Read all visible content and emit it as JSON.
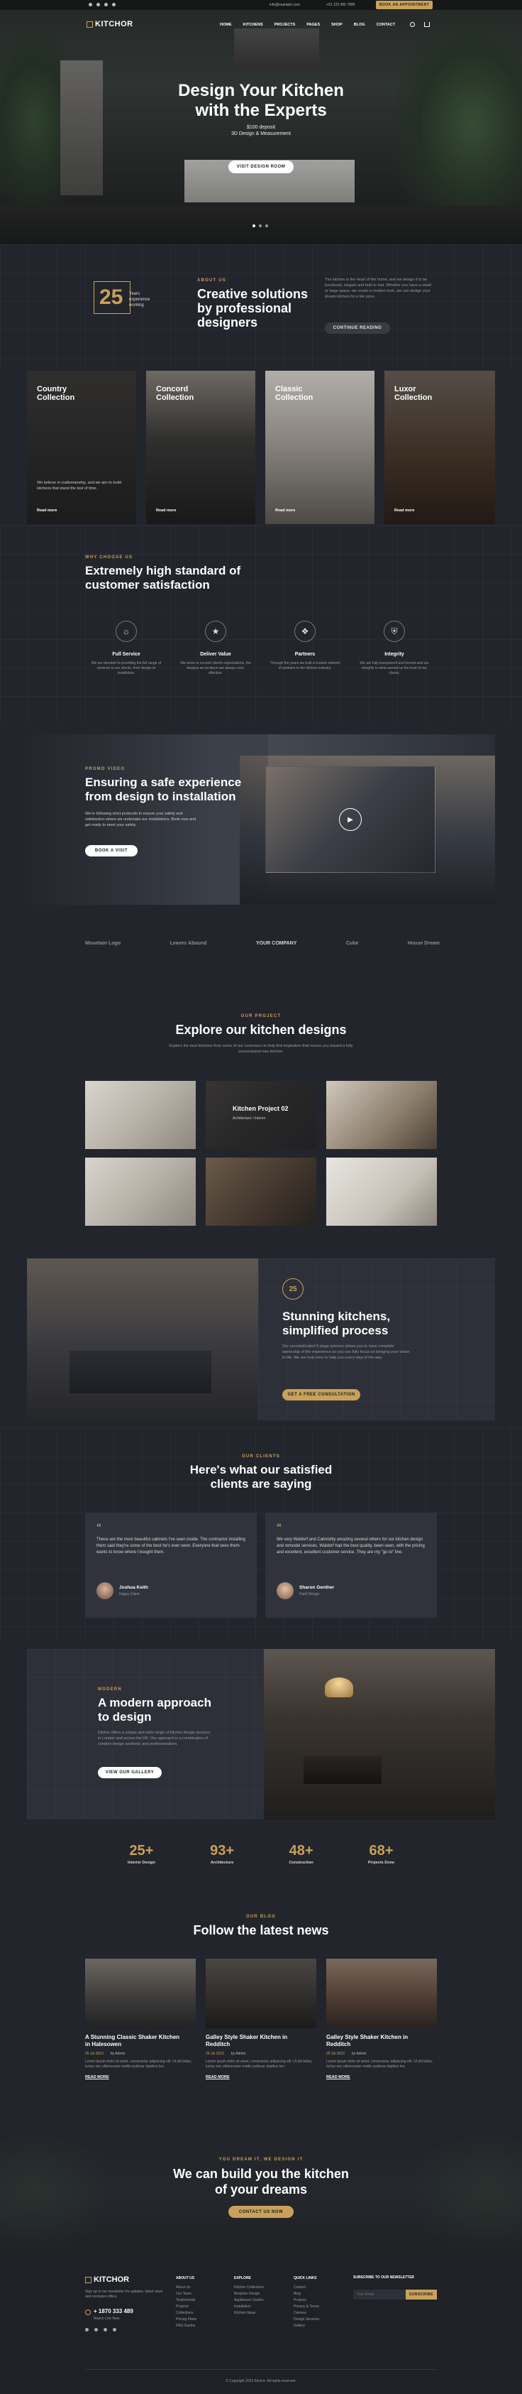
{
  "topbar": {
    "email": "info@example.com",
    "phone": "+91 123 456 7890",
    "cta": "BOOK AN APPOINTMENT"
  },
  "nav": {
    "brand": "KITCHOR",
    "items": [
      "HOME",
      "KITCHENS",
      "PROJECTS",
      "PAGES",
      "SHOP",
      "BLOG",
      "CONTACT"
    ]
  },
  "hero": {
    "title_line1": "Design Your Kitchen",
    "title_line2": "with the Experts",
    "sub1": "$100 deposit",
    "sub2": "3D Design & Measurement",
    "button": "VISIT DESIGN ROOM"
  },
  "about": {
    "years": "25",
    "years_label1": "Years",
    "years_label2": "experience",
    "years_label3": "working",
    "label": "ABOUT US",
    "title_line1": "Creative solutions",
    "title_line2": "by professional",
    "title_line3": "designers",
    "text": "The kitchen is the heart of the home, and we design it to be functional, elegant and built to last. Whether you have a small or large space, we create a modern look, we can design your dream kitchen for a fair price.",
    "button": "CONTINUE READING"
  },
  "collections": [
    {
      "title1": "Country",
      "title2": "Collection",
      "text": "We believe in craftsmanship, and we aim to build kitchens that stand the test of time.",
      "link": "Read more"
    },
    {
      "title1": "Concord",
      "title2": "Collection",
      "text": "",
      "link": "Read more"
    },
    {
      "title1": "Classic",
      "title2": "Collection",
      "text": "",
      "link": "Read more"
    },
    {
      "title1": "Luxor",
      "title2": "Collection",
      "text": "",
      "link": "Read more"
    }
  ],
  "why": {
    "label": "WHY CHOOSE US",
    "title_line1": "Extremely high standard of",
    "title_line2": "customer satisfaction",
    "features": [
      {
        "icon": "lightbulb-icon",
        "title": "Full Service",
        "text": "We are devoted to providing the full range of services to our clients, from design to installation."
      },
      {
        "icon": "tag-icon",
        "title": "Deliver Value",
        "text": "We strive to exceed client's expectations, the designs we produce are always cost-effective."
      },
      {
        "icon": "handshake-icon",
        "title": "Partners",
        "text": "Through the years we built a trusted network of partners in the kitchen industry."
      },
      {
        "icon": "shield-icon",
        "title": "Integrity",
        "text": "We are fully transparent and honest and our integrity is what earned us the trust of our clients."
      }
    ]
  },
  "video": {
    "label": "PROMO VIDEO",
    "title_line1": "Ensuring a safe experience",
    "title_line2": "from design to installation",
    "text": "We're following strict protocols to ensure your safety and satisfaction where we undertake our installations. Book now and get ready to meet your safety.",
    "button": "BOOK A VISIT"
  },
  "logos": [
    "Mountain Logo",
    "Leaves Abound",
    "YOUR COMPANY",
    "Cube",
    "House Dream"
  ],
  "projects": {
    "label": "OUR PROJECT",
    "title": "Explore our kitchen designs",
    "text": "Explore the best kitchens from some of our customers to help find inspiration that moves you toward a fully personalized new kitchen.",
    "featured_title": "Kitchen Project 02",
    "featured_meta": "Architecture / Interior"
  },
  "process": {
    "title_line1": "Stunning kitchens,",
    "title_line2": "simplified process",
    "text": "Our uncomplicated 5-stage process allows you to have complete ownership of the experience so you can fully focus on bringing your vision to life. We are truly here to help you every step of the way.",
    "button": "GET A FREE CONSULTATION",
    "badge": "25"
  },
  "testimonials": {
    "label": "OUR CLIENTS",
    "title_line1": "Here's what our satisfied",
    "title_line2": "clients are saying",
    "items": [
      {
        "text": "These are the most beautiful cabinets I've seen inside. The contractor installing them said they're some of the best he's ever seen. Everyone that sees them wants to know where I bought them.",
        "name": "Joshua Keith",
        "role": "Happy Client"
      },
      {
        "text": "We very Waldorf and Calmishly amazing several others for our kitchen design and remodel services. Waldorf had the best quality, been seen, with the pricing and excellent, excellent customer service. They are my \"go to\" line.",
        "name": "Sharon Genther",
        "role": "Paint Design"
      }
    ]
  },
  "modern": {
    "label": "MODERN",
    "title_line1": "A modern approach",
    "title_line2": "to design",
    "text": "Kitchor offers a unique and wide range of kitchen design services in London and across the UK. Our approach is a combination of creative design aesthetic and professionalism.",
    "button": "VIEW OUR GALLERY"
  },
  "stats": [
    {
      "value": "25+",
      "label": "Interior Design"
    },
    {
      "value": "93+",
      "label": "Architecture"
    },
    {
      "value": "48+",
      "label": "Construction"
    },
    {
      "value": "68+",
      "label": "Projects Done"
    }
  ],
  "blog": {
    "label": "OUR BLOG",
    "title": "Follow the latest news",
    "posts": [
      {
        "title1": "A Stunning Classic Shaker Kitchen",
        "title2": "in Halesowen",
        "date": "25 Jul 2023",
        "author": "by Admin",
        "text": "Lorem ipsum dolor sit amet, consectetur adipiscing elit. Ut elit tellus, luctus nec ullamcorper mattis pulvinar dapibus leo.",
        "link": "READ MORE"
      },
      {
        "title1": "Galley Style Shaker Kitchen in",
        "title2": "Redditch",
        "date": "25 Jul 2023",
        "author": "by Admin",
        "text": "Lorem ipsum dolor sit amet, consectetur adipiscing elit. Ut elit tellus, luctus nec ullamcorper mattis pulvinar dapibus leo.",
        "link": "READ MORE"
      },
      {
        "title1": "Galley Style Shaker Kitchen in",
        "title2": "Redditch",
        "date": "25 Jul 2023",
        "author": "by Admin",
        "text": "Lorem ipsum dolor sit amet, consectetur adipiscing elit. Ut elit tellus, luctus nec ullamcorper mattis pulvinar dapibus leo.",
        "link": "READ MORE"
      }
    ]
  },
  "cta": {
    "label": "YOU DREAM IT, WE DESIGN IT",
    "title_line1": "We can build you the kitchen",
    "title_line2": "of your dreams",
    "button": "CONTACT US NOW"
  },
  "footer": {
    "brand": "KITCHOR",
    "about": "Sign up to our newsletter for updates, latest news and exclusive offers.",
    "phone": "+ 1870 333 489",
    "phone_label": "Reach Live Now",
    "col1_title": "ABOUT US",
    "col1": [
      "About Us",
      "Our Team",
      "Testimonials",
      "Projects",
      "Collections",
      "Pricing Plans",
      "FAQ Guides"
    ],
    "col2_title": "EXPLORE",
    "col2": [
      "Kitchen Collections",
      "Bespoke Design",
      "Appliances Guides",
      "Installation",
      "Kitchen Ideas"
    ],
    "col3_title": "QUICK LINKS",
    "col3": [
      "Contact",
      "Blog",
      "Projects",
      "Privacy & Terms",
      "Careers",
      "Design Services",
      "Gallery"
    ],
    "col4_title": "SUBSCRIBE TO OUR NEWSLETTER",
    "subscribe_placeholder": "Your Email",
    "subscribe_button": "SUBSCRIBE",
    "copyright": "© Copyright 2023 Kitchor. All rights reserved."
  },
  "colors": {
    "accent": "#c9a15a",
    "background": "#23252c",
    "panel": "#2d3038"
  }
}
